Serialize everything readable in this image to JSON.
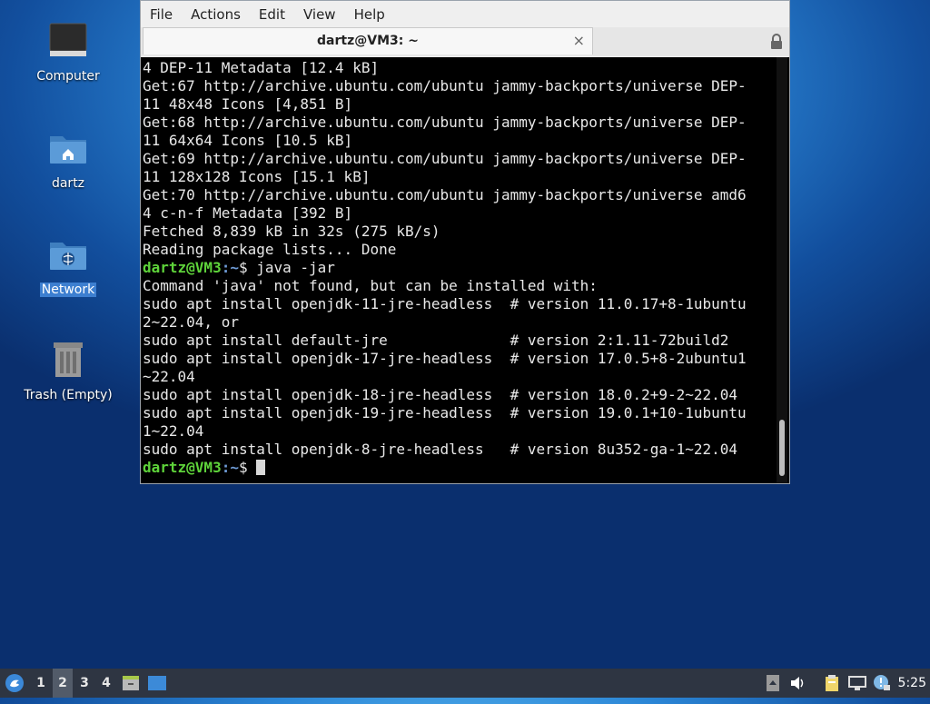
{
  "desktop": {
    "icons": [
      {
        "label": "Computer"
      },
      {
        "label": "dartz"
      },
      {
        "label": "Network"
      },
      {
        "label": "Trash (Empty)"
      }
    ]
  },
  "window": {
    "menu": [
      "File",
      "Actions",
      "Edit",
      "View",
      "Help"
    ],
    "tab_title": "dartz@VM3: ~",
    "tab_close": "×",
    "terminal": {
      "lines_before": [
        "4 DEP-11 Metadata [12.4 kB]",
        "Get:67 http://archive.ubuntu.com/ubuntu jammy-backports/universe DEP-",
        "11 48x48 Icons [4,851 B]",
        "Get:68 http://archive.ubuntu.com/ubuntu jammy-backports/universe DEP-",
        "11 64x64 Icons [10.5 kB]",
        "Get:69 http://archive.ubuntu.com/ubuntu jammy-backports/universe DEP-",
        "11 128x128 Icons [15.1 kB]",
        "Get:70 http://archive.ubuntu.com/ubuntu jammy-backports/universe amd6",
        "4 c-n-f Metadata [392 B]",
        "Fetched 8,839 kB in 32s (275 kB/s)",
        "Reading package lists... Done"
      ],
      "prompt_user": "dartz@VM3",
      "prompt_path": ":~",
      "prompt_symbol": "$",
      "command": " java -jar",
      "output_lines": [
        "Command 'java' not found, but can be installed with:",
        "sudo apt install openjdk-11-jre-headless  # version 11.0.17+8-1ubuntu",
        "2~22.04, or",
        "sudo apt install default-jre              # version 2:1.11-72build2",
        "sudo apt install openjdk-17-jre-headless  # version 17.0.5+8-2ubuntu1",
        "~22.04",
        "sudo apt install openjdk-18-jre-headless  # version 18.0.2+9-2~22.04",
        "sudo apt install openjdk-19-jre-headless  # version 19.0.1+10-1ubuntu",
        "1~22.04",
        "sudo apt install openjdk-8-jre-headless   # version 8u352-ga-1~22.04"
      ]
    }
  },
  "taskbar": {
    "workspaces": [
      "1",
      "2",
      "3",
      "4"
    ],
    "active_workspace": "2",
    "clock": "5:25"
  }
}
